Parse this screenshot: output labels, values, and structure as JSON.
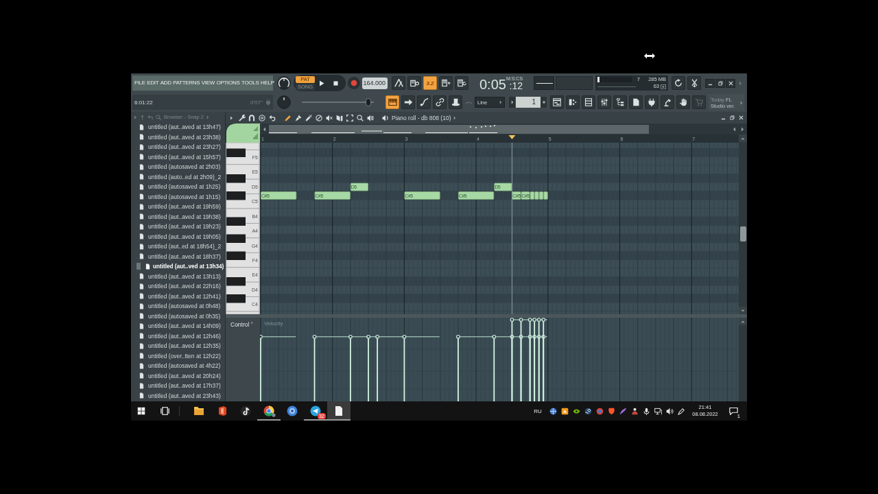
{
  "toolbar": {
    "menu": [
      "FILE",
      "EDIT",
      "ADD",
      "PATTERNS",
      "VIEW",
      "OPTIONS",
      "TOOLS",
      "HELP"
    ],
    "modes": [
      {
        "label": "PAT",
        "selected": true
      },
      {
        "label": "SONG",
        "selected": false
      }
    ],
    "tempo": "164.000",
    "toggles": [
      {
        "on": false
      },
      {
        "on": false
      },
      {
        "on": true,
        "label": "3.2"
      },
      {
        "on": false
      },
      {
        "on": false
      }
    ],
    "time": {
      "main": "0:05",
      "sub": ":12",
      "unit": "M:S:CS"
    },
    "cpu": {
      "level": 0.06,
      "polyphony": "7",
      "memory": "285 MB",
      "load": "63"
    },
    "hint": {
      "text": "6:01:22",
      "aside": "0'07''"
    },
    "position": {
      "level": 0.92
    },
    "views": [
      {
        "on": true
      },
      {
        "on": false
      },
      {
        "on": false
      },
      {
        "on": false
      },
      {
        "on": false
      }
    ],
    "snap": "Line",
    "pattern": "1",
    "windows": [
      {
        "disabled": false
      },
      {
        "disabled": false
      },
      {
        "disabled": false
      },
      {
        "disabled": false
      },
      {
        "disabled": false
      },
      {
        "disabled": false
      },
      {
        "disabled": false
      },
      {
        "disabled": false
      },
      {
        "disabled": false
      },
      {
        "disabled": true
      }
    ],
    "news": {
      "tag": "Today",
      "text": "FL Studio ver."
    }
  },
  "browser": {
    "title": "Browser - Snap 2",
    "items": [
      {
        "label": "untitled (aut..aved at 13h47)",
        "selected": false
      },
      {
        "label": "untitled (aut..aved at 23h38)",
        "selected": false
      },
      {
        "label": "untitled (aut..aved at 23h27)",
        "selected": false
      },
      {
        "label": "untitled (aut..aved at 15h57)",
        "selected": false
      },
      {
        "label": "untitled (autosaved at 2h03)",
        "selected": false
      },
      {
        "label": "untitled (auto..ed at 2h09)_2",
        "selected": false
      },
      {
        "label": "untitled (autosaved at 1h25)",
        "selected": false
      },
      {
        "label": "untitled (autosaved at 1h15)",
        "selected": false
      },
      {
        "label": "untitled (aut..aved at 19h59)",
        "selected": false
      },
      {
        "label": "untitled (aut..aved at 19h38)",
        "selected": false
      },
      {
        "label": "untitled (aut..aved at 19h23)",
        "selected": false
      },
      {
        "label": "untitled (aut..aved at 19h05)",
        "selected": false
      },
      {
        "label": "untitled (aut..ed at 18h54)_2",
        "selected": false
      },
      {
        "label": "untitled (aut..aved at 18h37)",
        "selected": false
      },
      {
        "label": "untitled (aut..ved at 13h34)",
        "selected": true
      },
      {
        "label": "untitled (aut..aved at 13h13)",
        "selected": false
      },
      {
        "label": "untitled (aut..aved at 22h16)",
        "selected": false
      },
      {
        "label": "untitled (aut..aved at 12h41)",
        "selected": false
      },
      {
        "label": "untitled (autosaved at 0h48)",
        "selected": false
      },
      {
        "label": "untitled (autosaved at 0h35)",
        "selected": false
      },
      {
        "label": "untitled (aut..aved at 14h09)",
        "selected": false
      },
      {
        "label": "untitled (aut..aved at 12h46)",
        "selected": false
      },
      {
        "label": "untitled (aut..aved at 12h35)",
        "selected": false
      },
      {
        "label": "untitled (over..tten at 12h22)",
        "selected": false
      },
      {
        "label": "untitled (autosaved at 4h22)",
        "selected": false
      },
      {
        "label": "untitled (aut..aved at 20h24)",
        "selected": false
      },
      {
        "label": "untitled (aut..aved at 17h37)",
        "selected": false
      },
      {
        "label": "untitled (aut..aved at 23h43)",
        "selected": false
      }
    ]
  },
  "piano_roll": {
    "title": "Piano roll - db 808 (10)",
    "tools": [
      {
        "selected": true
      },
      {
        "selected": false
      },
      {
        "selected": false
      },
      {
        "selected": false
      },
      {
        "selected": false
      },
      {
        "selected": false
      },
      {
        "selected": false
      },
      {
        "selected": false
      },
      {
        "selected": false
      }
    ],
    "ruler": [
      "1",
      "2",
      "3",
      "4",
      "5",
      "6",
      "7"
    ],
    "keys": [
      "F5",
      "E5",
      "D5",
      "C5",
      "B4",
      "A4",
      "G4",
      "F4",
      "E4",
      "D4",
      "C4"
    ],
    "notes": [
      {
        "label": "C#5",
        "selected": false
      },
      {
        "label": "C#5",
        "selected": false
      },
      {
        "label": "D5",
        "selected": false
      },
      {
        "label": "C#5",
        "selected": false
      },
      {
        "label": "C#5",
        "selected": false
      },
      {
        "label": "D5",
        "selected": false
      },
      {
        "label": "C#5",
        "selected": false
      },
      {
        "label": "C#5",
        "selected": false
      },
      {
        "selected": false
      },
      {
        "selected": false
      },
      {
        "selected": false
      },
      {
        "selected": false
      }
    ],
    "control": {
      "label": "Control",
      "parameter": "Velocity"
    }
  },
  "taskbar": {
    "apps": [
      {
        "running": false,
        "selected": false
      },
      {
        "running": false,
        "selected": false
      },
      {
        "running": false,
        "selected": false
      },
      {
        "running": true,
        "selected": false
      },
      {
        "running": false,
        "selected": false
      },
      {
        "running": true,
        "selected": false,
        "badge": "32"
      },
      {
        "running": true,
        "selected": true
      }
    ],
    "language": "RU",
    "time": "21:41",
    "date": "08.08.2022",
    "notifications": "1"
  }
}
